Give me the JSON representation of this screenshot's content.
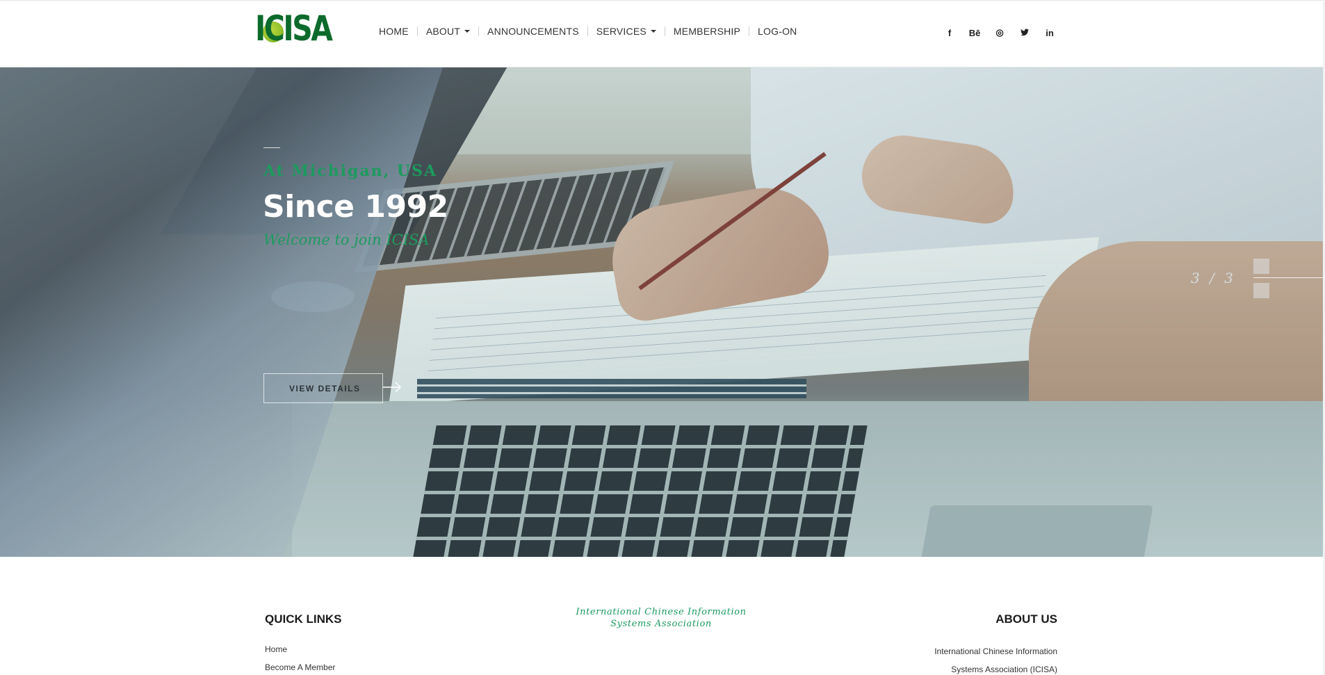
{
  "header": {
    "logo_text": "ICISA",
    "nav": [
      {
        "label": "HOME",
        "dropdown": false
      },
      {
        "label": "ABOUT",
        "dropdown": true
      },
      {
        "label": "ANNOUNCEMENTS",
        "dropdown": false
      },
      {
        "label": "SERVICES",
        "dropdown": true
      },
      {
        "label": "MEMBERSHIP",
        "dropdown": false
      },
      {
        "label": "LOG-ON",
        "dropdown": false
      }
    ],
    "social": [
      {
        "icon": "facebook-icon",
        "glyph": "f"
      },
      {
        "icon": "behance-icon",
        "glyph": "Bē"
      },
      {
        "icon": "instagram-icon",
        "glyph": "◎"
      },
      {
        "icon": "twitter-icon",
        "glyph": "🐦"
      },
      {
        "icon": "linkedin-icon",
        "glyph": "in"
      }
    ]
  },
  "hero": {
    "location": "At Michigan, USA",
    "headline": "Since 1992",
    "tagline": "Welcome to join ICISA",
    "button_label": "VIEW DETAILS",
    "counter": "3 / 3",
    "accent_color": "#1d9a5f"
  },
  "footer": {
    "quick_links_title": "QUICK LINKS",
    "quick_links": [
      "Home",
      "Become A Member"
    ],
    "org_name": "International Chinese Information Systems Association",
    "about_title": "ABOUT US",
    "about_text_lines": [
      "International Chinese Information",
      "Systems Association (ICISA)"
    ]
  },
  "colors": {
    "brand_green": "#0c6b2c",
    "accent_green": "#1d9a5f"
  }
}
